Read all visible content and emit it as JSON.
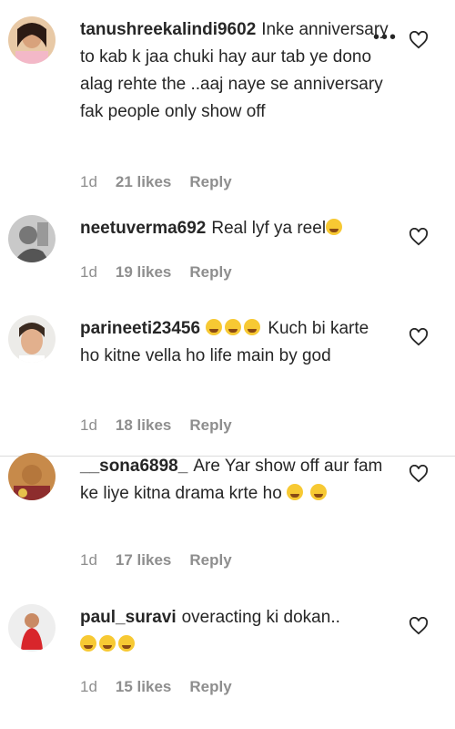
{
  "comments": [
    {
      "username": "tanushreekalindi9602",
      "text": "Inke anniversary to kab k jaa chuki hay aur tab ye dono alag rehte the ..aaj naye se anniversary fak people only show off",
      "time": "1d",
      "likes": "21 likes",
      "reply": "Reply"
    },
    {
      "username": "neetuverma692",
      "text": "Real lyf ya reel",
      "time": "1d",
      "likes": "19 likes",
      "reply": "Reply"
    },
    {
      "username": "parineeti23456",
      "text": "Kuch bi karte ho kitne vella ho life main by god",
      "time": "1d",
      "likes": "18 likes",
      "reply": "Reply"
    },
    {
      "username": "__sona6898_",
      "text": "Are Yar show off aur fam ke liye kitna drama krte ho",
      "time": "1d",
      "likes": "17 likes",
      "reply": "Reply"
    },
    {
      "username": "paul_suravi",
      "text": "overacting ki dokan..",
      "time": "1d",
      "likes": "15 likes",
      "reply": "Reply"
    }
  ],
  "more_options": "•••"
}
